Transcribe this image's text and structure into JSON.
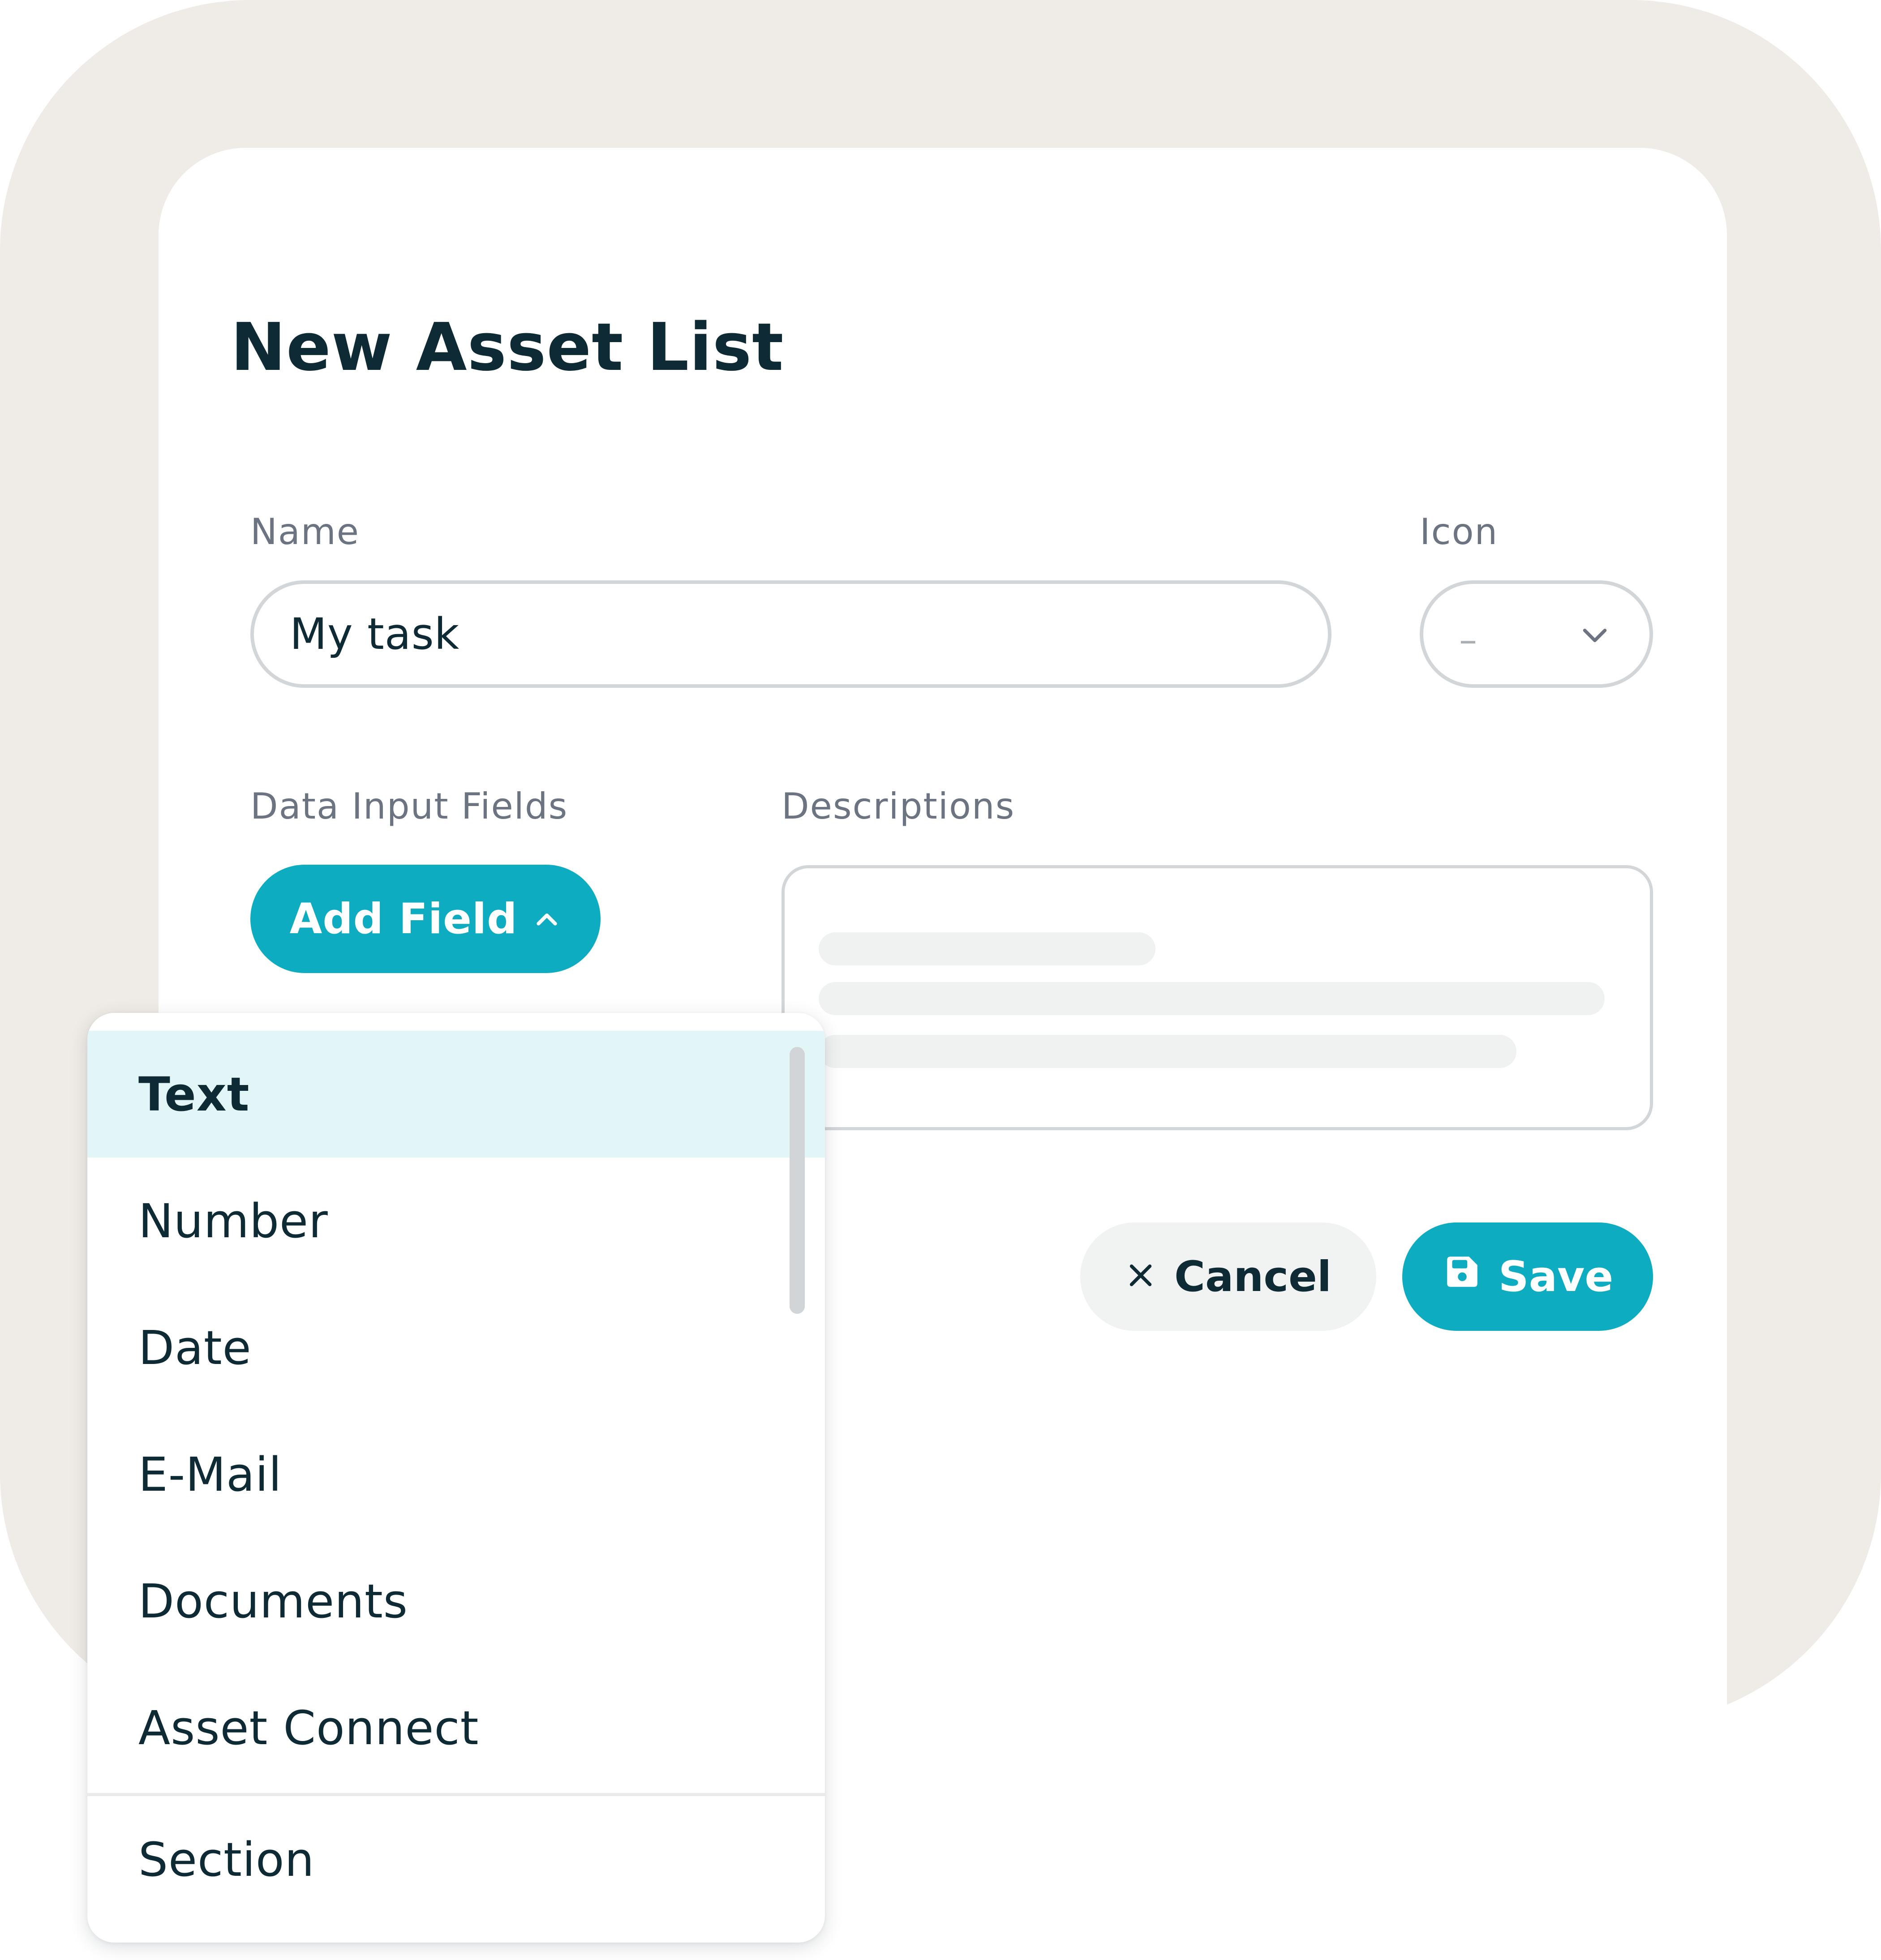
{
  "dialog": {
    "title": "New Asset List"
  },
  "name_field": {
    "label": "Name",
    "value": "My task"
  },
  "icon_field": {
    "label": "Icon",
    "value": "–",
    "icon": "chevron-down-icon"
  },
  "data_input": {
    "label": "Data Input Fields",
    "add_button_label": "Add Field",
    "add_button_icon": "chevron-up-icon"
  },
  "descriptions": {
    "label": "Descriptions"
  },
  "actions": {
    "cancel_label": "Cancel",
    "cancel_icon": "close-icon",
    "save_label": "Save",
    "save_icon": "save-icon"
  },
  "field_menu": {
    "items": [
      {
        "label": "Text",
        "selected": true
      },
      {
        "label": "Number",
        "selected": false
      },
      {
        "label": "Date",
        "selected": false
      },
      {
        "label": "E-Mail",
        "selected": false
      },
      {
        "label": "Documents",
        "selected": false
      },
      {
        "label": "Asset Connect",
        "selected": false
      },
      {
        "label": "Section",
        "selected": false
      }
    ]
  },
  "colors": {
    "accent": "#0eacc1",
    "text_dark": "#0d2a35",
    "label_gray": "#6b7480",
    "background_beige": "#efebe6",
    "selected_row": "#e3f6f7"
  }
}
